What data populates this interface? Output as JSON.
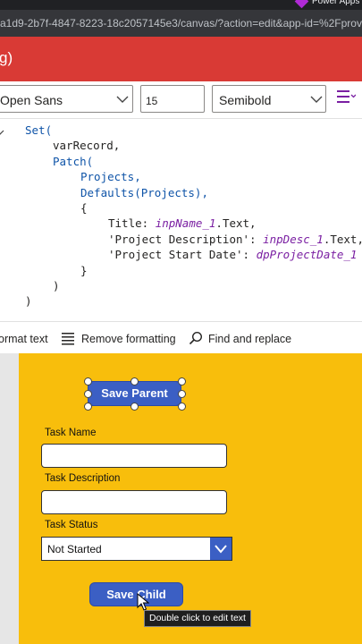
{
  "browser": {
    "tab_title": "Power Apps",
    "url": "a1d9-2b7f-4847-8223-18c2057145e3/canvas/?action=edit&app-id=%2Fprovid"
  },
  "appbar": {
    "title": "g)"
  },
  "toolbar": {
    "font_family": "Open Sans",
    "font_size": "15",
    "font_weight": "Semibold",
    "menu_icon": "hamburger-icon"
  },
  "formula": {
    "lines": [
      {
        "parts": [
          {
            "t": "fn",
            "v": "Set("
          }
        ]
      },
      {
        "parts": [
          {
            "t": "ident",
            "v": "varRecord,"
          }
        ]
      },
      {
        "parts": [
          {
            "t": "fn",
            "v": "Patch("
          }
        ]
      },
      {
        "parts": [
          {
            "t": "fn",
            "v": "Projects,"
          }
        ]
      },
      {
        "parts": [
          {
            "t": "fn",
            "v": "Defaults(Projects),"
          }
        ]
      },
      {
        "parts": [
          {
            "t": "ident",
            "v": "{"
          }
        ]
      },
      {
        "parts": [
          {
            "t": "str",
            "v": "Title: "
          },
          {
            "t": "ctrl",
            "v": "inpName_1"
          },
          {
            "t": "str",
            "v": ".Text,"
          }
        ]
      },
      {
        "parts": [
          {
            "t": "str",
            "v": "'Project Description': "
          },
          {
            "t": "ctrl",
            "v": "inpDesc_1"
          },
          {
            "t": "str",
            "v": ".Text,"
          }
        ]
      },
      {
        "parts": [
          {
            "t": "str",
            "v": "'Project Start Date': "
          },
          {
            "t": "ctrl",
            "v": "dpProjectDate_1"
          }
        ]
      },
      {
        "parts": [
          {
            "t": "ident",
            "v": "}"
          }
        ]
      },
      {
        "parts": [
          {
            "t": "ident",
            "v": ")"
          }
        ]
      },
      {
        "parts": [
          {
            "t": "ident",
            "v": ")"
          }
        ]
      }
    ]
  },
  "actions": {
    "format_text": "ormat text",
    "remove_formatting": "Remove formatting",
    "find_replace": "Find and replace"
  },
  "canvas": {
    "save_parent": "Save Parent",
    "task_name_label": "Task Name",
    "task_name_value": "",
    "task_description_label": "Task Description",
    "task_description_value": "",
    "task_status_label": "Task Status",
    "task_status_value": "Not Started",
    "save_child": "Save Child",
    "tooltip": "Double click to edit text"
  },
  "colors": {
    "app_bar": "#d93a35",
    "screen_background": "#f8be0c",
    "button": "#3b5fc4",
    "code_function": "#0f54a8",
    "code_control": "#7a1fa2"
  }
}
